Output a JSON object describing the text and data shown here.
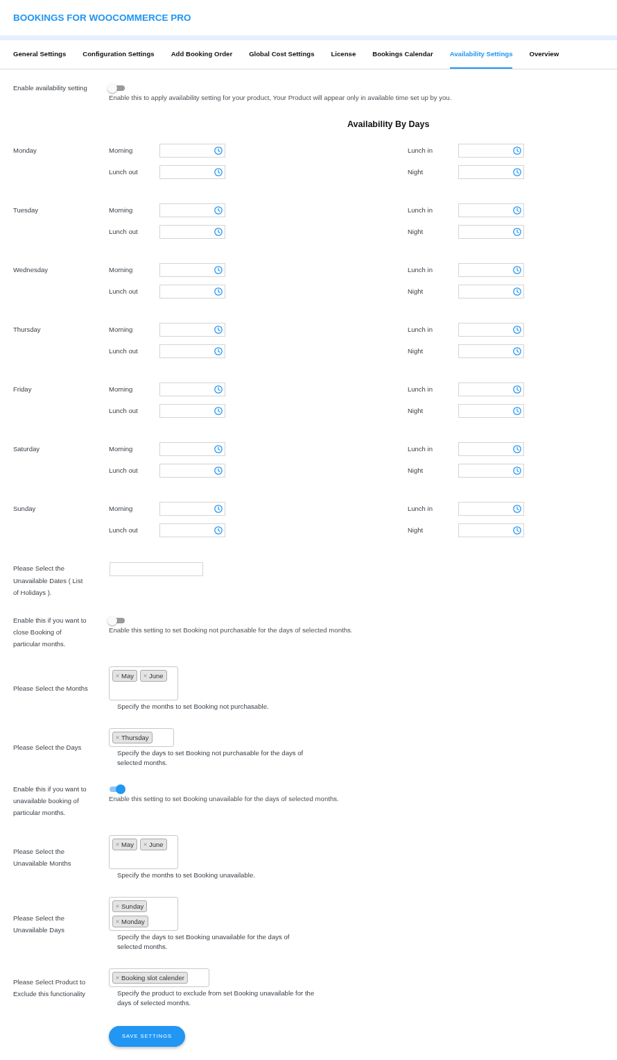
{
  "header": {
    "title": "BOOKINGS FOR WOOCOMMERCE PRO"
  },
  "tabs": [
    {
      "label": "General Settings",
      "selected": false
    },
    {
      "label": "Configuration Settings",
      "selected": false
    },
    {
      "label": "Add Booking Order",
      "selected": false
    },
    {
      "label": "Global Cost Settings",
      "selected": false
    },
    {
      "label": "License",
      "selected": false
    },
    {
      "label": "Bookings Calendar",
      "selected": false
    },
    {
      "label": "Availability Settings",
      "selected": true
    },
    {
      "label": "Overview",
      "selected": false
    }
  ],
  "availability": {
    "label": "Enable availability setting",
    "on": false,
    "description": "Enable this to apply availability setting for your product, Your Product will appear only in available time set up by you."
  },
  "days_section": {
    "heading": "Availability By Days",
    "days": [
      {
        "name": "Monday",
        "slots": [
          "Morning",
          "Lunch in",
          "Lunch out",
          "Night"
        ]
      },
      {
        "name": "Tuesday",
        "slots": [
          "Morning",
          "Lunch in",
          "Lunch out",
          "Night"
        ]
      },
      {
        "name": "Wednesday",
        "slots": [
          "Morning",
          "Lunch in",
          "Lunch out",
          "Night"
        ]
      },
      {
        "name": "Thursday",
        "slots": [
          "Morning",
          "Lunch in",
          "Lunch out",
          "Night"
        ]
      },
      {
        "name": "Friday",
        "slots": [
          "Morning",
          "Lunch in",
          "Lunch out",
          "Night"
        ]
      },
      {
        "name": "Saturday",
        "slots": [
          "Morning",
          "Lunch in",
          "Lunch out",
          "Night"
        ]
      },
      {
        "name": "Sunday",
        "slots": [
          "Morning",
          "Lunch in",
          "Lunch out",
          "Night"
        ]
      }
    ]
  },
  "settings": [
    {
      "kind": "text",
      "label": "Please Select the Unavailable Dates ( List of Holidays )."
    },
    {
      "kind": "toggle",
      "label": "Enable this if you want to close Booking of particular months.",
      "on": false,
      "description": "Enable this setting to set Booking not purchasable for the days of selected months."
    },
    {
      "kind": "tags",
      "label": "Please Select the Months",
      "tags": [
        "May",
        "June"
      ],
      "help": "Specify the months to set Booking not purchasable."
    },
    {
      "kind": "tags",
      "label": "Please Select the Days",
      "tags": [
        "Thursday"
      ],
      "help": "Specify the days to set Booking not purchasable for the days of selected months."
    },
    {
      "kind": "toggle",
      "label": "Enable this if you want to unavailable booking of particular months.",
      "on": true,
      "description": "Enable this setting to set Booking unavailable for the days of selected months."
    },
    {
      "kind": "tags",
      "label": "Please Select the Unavailable Months",
      "tags": [
        "May",
        "June"
      ],
      "help": "Specify the months to set Booking unavailable."
    },
    {
      "kind": "tags",
      "label": "Please Select the Unavailable Days",
      "tags": [
        "Sunday",
        "Monday"
      ],
      "help": "Specify the days to set Booking unavailable for the days of selected months."
    },
    {
      "kind": "tags",
      "label": "Please Select Product to Exclude this functionality",
      "tags": [
        "Booking slot calender"
      ],
      "help": "Specify the product to exclude from set Booking unavailable for the days of selected months."
    }
  ],
  "save_button": {
    "label": "SAVE SETTINGS"
  }
}
